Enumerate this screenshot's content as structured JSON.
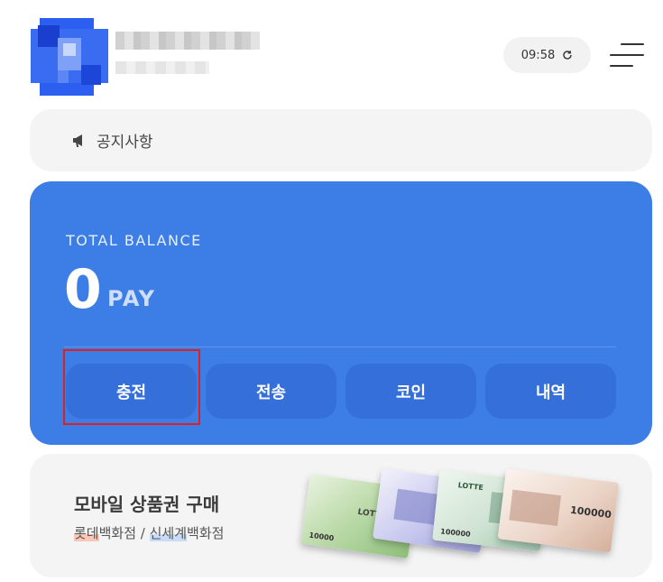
{
  "header": {
    "time": "09:58"
  },
  "notice": {
    "label": "공지사항"
  },
  "balance": {
    "label": "TOTAL BALANCE",
    "amount": "0",
    "unit": "PAY",
    "actions": [
      {
        "label": "충전"
      },
      {
        "label": "전송"
      },
      {
        "label": "코인"
      },
      {
        "label": "내역"
      }
    ]
  },
  "gift": {
    "title": "모바일 상품권 구매",
    "sub_store1_mark": "롯데",
    "sub_store1_rest": "백화점",
    "sub_sep": " / ",
    "sub_store2_mark": "신세계",
    "sub_store2_rest": "백화점",
    "vouchers": [
      {
        "amount": "10000",
        "logo": "LOTTE"
      },
      {
        "amount": "",
        "logo": ""
      },
      {
        "amount": "100000",
        "logo": "LOTTE"
      },
      {
        "amount": "100000",
        "logo": ""
      }
    ]
  },
  "colors": {
    "primary": "#3d7ee6",
    "button": "#356fd9",
    "highlight": "#e02020"
  }
}
